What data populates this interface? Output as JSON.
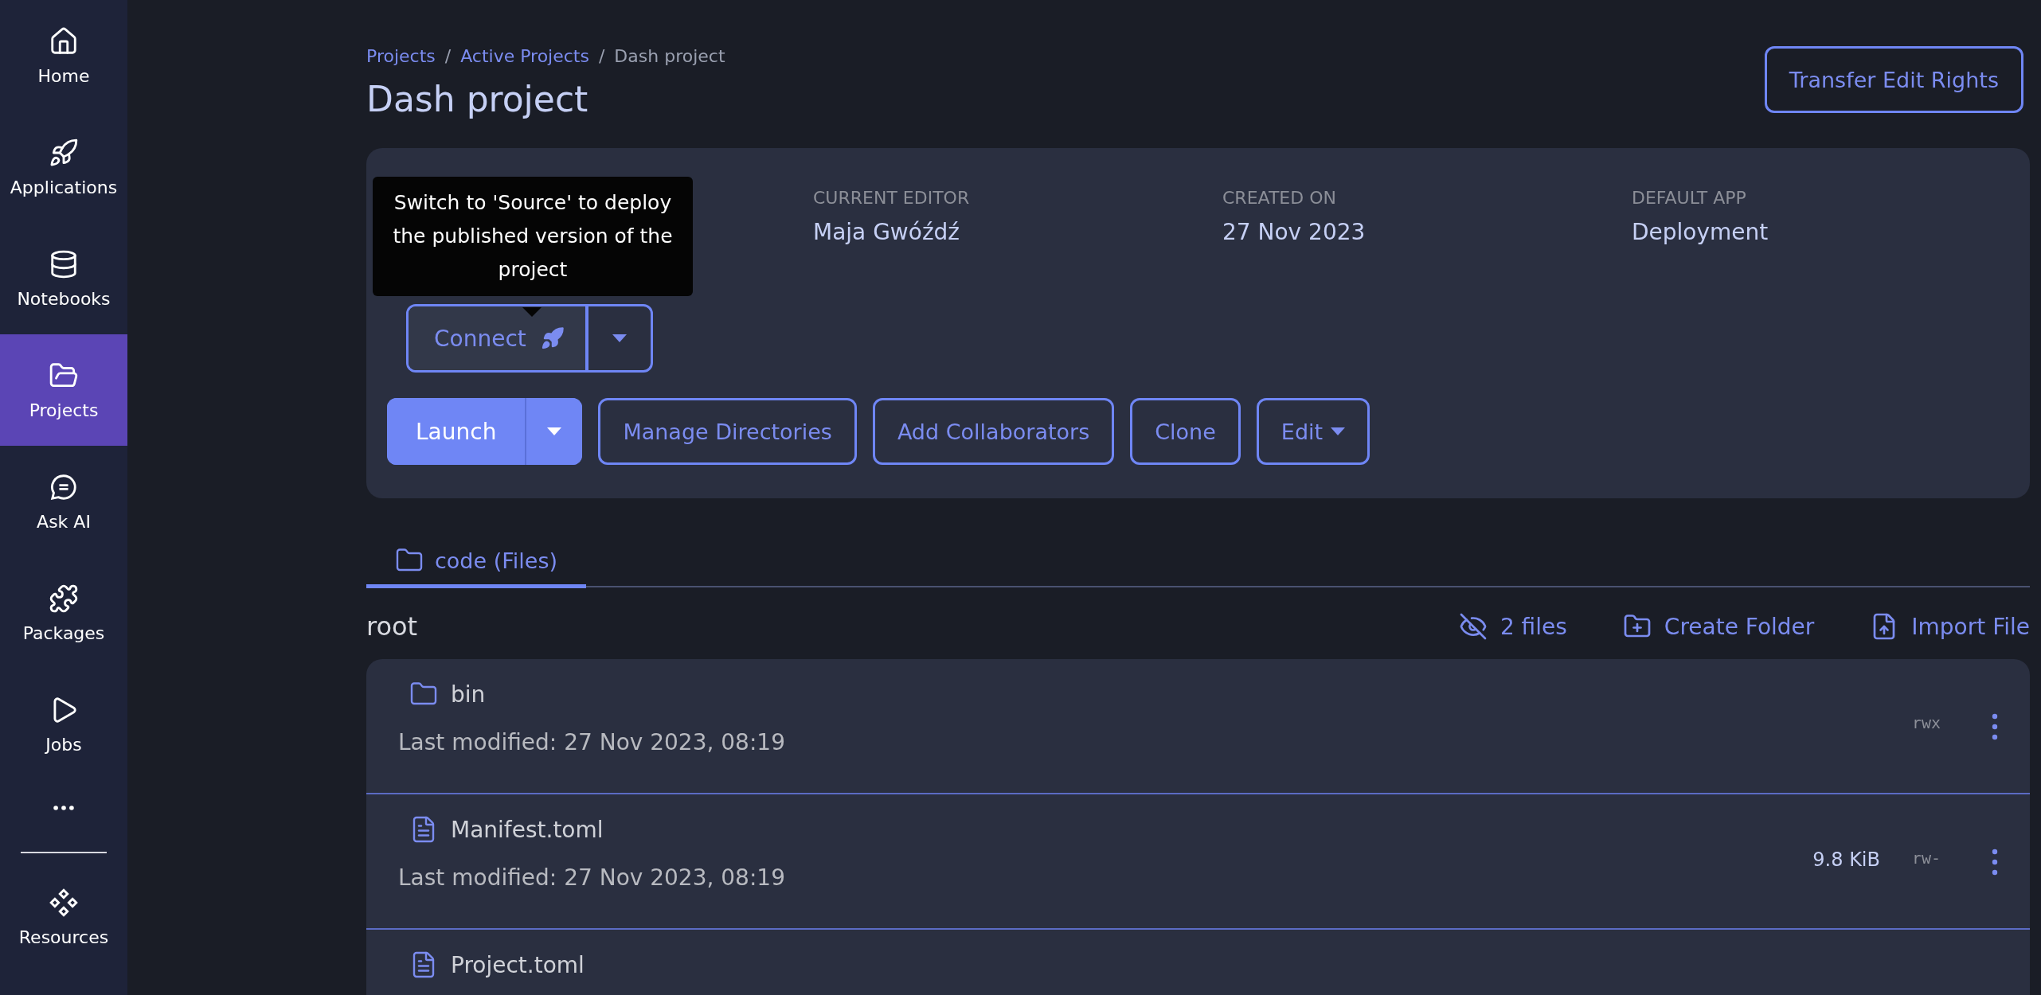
{
  "sidebar": {
    "items": [
      {
        "label": "Home",
        "selected": false
      },
      {
        "label": "Applications",
        "selected": false
      },
      {
        "label": "Notebooks",
        "selected": false
      },
      {
        "label": "Projects",
        "selected": true
      },
      {
        "label": "Ask AI",
        "selected": false
      },
      {
        "label": "Packages",
        "selected": false
      },
      {
        "label": "Jobs",
        "selected": false
      }
    ],
    "bottom_items": [
      {
        "label": "Resources",
        "selected": false
      }
    ]
  },
  "breadcrumb": [
    {
      "kind": "link",
      "label": "Projects"
    },
    {
      "kind": "separator",
      "label": "/"
    },
    {
      "kind": "link",
      "label": "Active Projects"
    },
    {
      "kind": "separator",
      "label": "/"
    },
    {
      "kind": "current",
      "label": "Dash project"
    }
  ],
  "title": "Dash project",
  "transfer_button": "Transfer Edit Rights",
  "details": [
    {
      "label": "CURRENT EDITOR",
      "value": "Maja Gwóźdź"
    },
    {
      "label": "CREATED ON",
      "value": "27 Nov 2023"
    },
    {
      "label": "DEFAULT APP",
      "value": "Deployment"
    }
  ],
  "tooltip": "Switch to 'Source' to deploy the published version of the project",
  "connect_button": "Connect",
  "actions": [
    {
      "kind": "split",
      "label": "Launch"
    },
    {
      "kind": "outline",
      "label": "Manage Directories"
    },
    {
      "kind": "outline",
      "label": "Add Collaborators"
    },
    {
      "kind": "outline",
      "label": "Clone"
    },
    {
      "kind": "dropdown",
      "label": "Edit"
    }
  ],
  "tabs": [
    {
      "label": "code (Files)",
      "selected": true
    }
  ],
  "folder": {
    "name": "root",
    "tools": [
      {
        "label": "2 files"
      },
      {
        "label": "Create Folder"
      },
      {
        "label": "Import File"
      }
    ]
  },
  "files": [
    {
      "kind": "folder",
      "name": "bin",
      "modified": "Last modified: 27 Nov 2023, 08:19",
      "permissions": "rwx"
    },
    {
      "kind": "file",
      "name": "Manifest.toml",
      "modified": "Last modified: 27 Nov 2023, 08:19",
      "size": "9.8 KiB",
      "permissions": "rw-"
    },
    {
      "kind": "file",
      "name": "Project.toml"
    }
  ]
}
